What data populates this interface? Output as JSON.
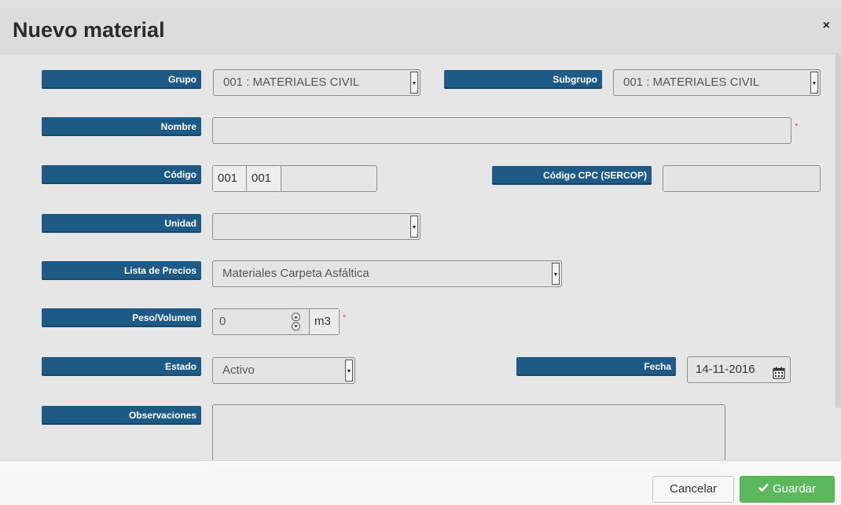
{
  "modal": {
    "title": "Nuevo material",
    "close_symbol": "×"
  },
  "form": {
    "grupo": {
      "label": "Grupo",
      "value": "001 : MATERIALES CIVIL"
    },
    "subgrupo": {
      "label": "Subgrupo",
      "value": "001 : MATERIALES CIVIL"
    },
    "nombre": {
      "label": "Nombre",
      "value": "",
      "required_mark": "*"
    },
    "codigo": {
      "label": "Código",
      "part1": "001",
      "part2": "001",
      "value": ""
    },
    "codigo_cpc": {
      "label": "Código CPC (SERCOP)",
      "value": ""
    },
    "unidad": {
      "label": "Unidad",
      "value": ""
    },
    "lista_precios": {
      "label": "Lista de Precios",
      "value": "Materiales Carpeta Asfáltica"
    },
    "peso_volumen": {
      "label": "Peso/Volumen",
      "value": "0",
      "unit": "m3",
      "required_mark": "*"
    },
    "estado": {
      "label": "Estado",
      "value": "Activo"
    },
    "fecha": {
      "label": "Fecha",
      "value": "14-11-2016",
      "icon": "calendar-icon"
    },
    "observaciones": {
      "label": "Observaciones",
      "value": ""
    }
  },
  "footer": {
    "cancel_label": "Cancelar",
    "save_label": "Guardar",
    "save_icon": "check-icon"
  },
  "colors": {
    "label_bg": "#1d5a86",
    "save_btn": "#5cb85c",
    "required": "#d9534f"
  }
}
